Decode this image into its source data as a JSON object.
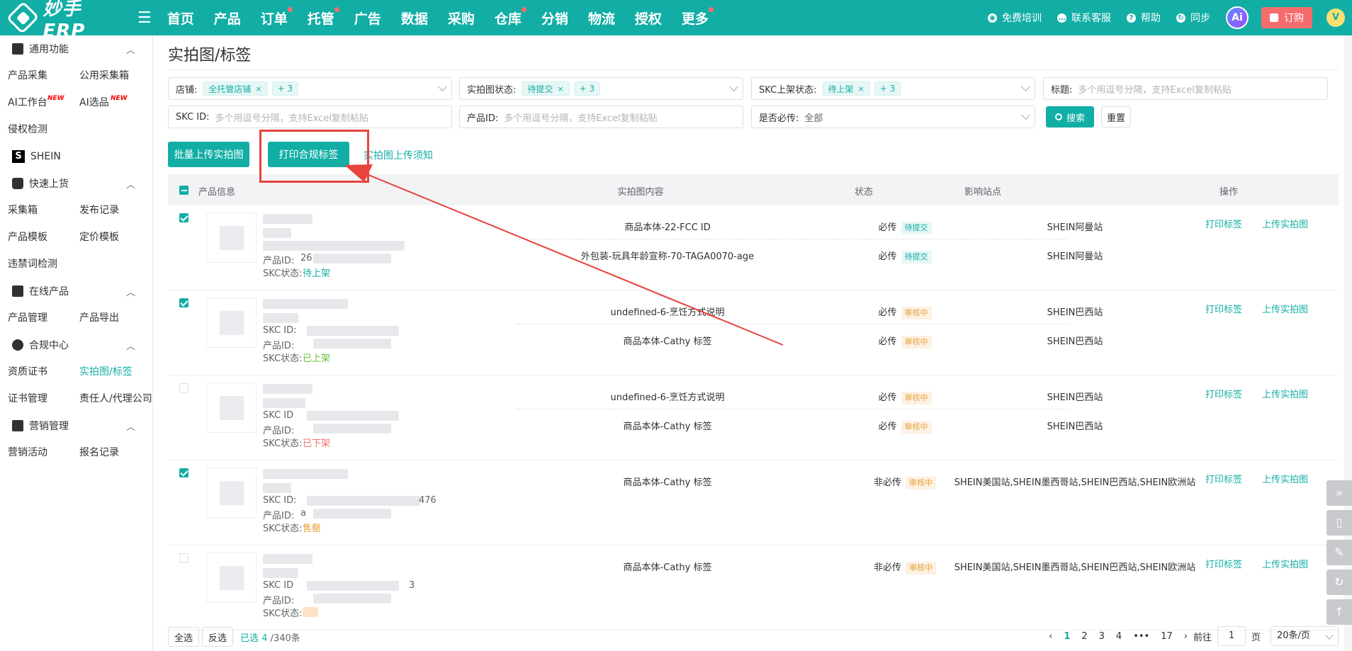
{
  "brand": {
    "logo_text": "妙手ERP"
  },
  "nav": [
    {
      "label": "首页",
      "dot": false
    },
    {
      "label": "产品",
      "dot": false
    },
    {
      "label": "订单",
      "dot": true
    },
    {
      "label": "托管",
      "dot": true
    },
    {
      "label": "广告",
      "dot": false
    },
    {
      "label": "数据",
      "dot": false
    },
    {
      "label": "采购",
      "dot": false
    },
    {
      "label": "仓库",
      "dot": true
    },
    {
      "label": "分销",
      "dot": false
    },
    {
      "label": "物流",
      "dot": false
    },
    {
      "label": "授权",
      "dot": false
    },
    {
      "label": "更多",
      "dot": true
    }
  ],
  "tools": {
    "training": "免费培训",
    "contact": "联系客服",
    "help": "帮助",
    "sync": "同步",
    "ai": "Ai",
    "order": "订购",
    "user_initial": "V"
  },
  "sidebar": {
    "general": {
      "title": "通用功能",
      "items": [
        "产品采集",
        "公用采集箱",
        "AI工作台",
        "AI选品",
        "侵权检测"
      ],
      "new_tag": "NEW"
    },
    "shein": "SHEIN",
    "quick": {
      "title": "快速上货",
      "items": [
        "采集箱",
        "发布记录",
        "产品模板",
        "定价模板",
        "违禁词检测"
      ]
    },
    "online": {
      "title": "在线产品",
      "items": [
        "产品管理",
        "产品导出"
      ]
    },
    "compliance": {
      "title": "合规中心",
      "items": [
        "资质证书",
        "实拍图/标签",
        "证书管理",
        "责任人/代理公司"
      ]
    },
    "marketing": {
      "title": "营销管理",
      "items": [
        "营销活动",
        "报名记录"
      ]
    }
  },
  "page": {
    "title": "实拍图/标签"
  },
  "filters": {
    "store": {
      "label": "店铺:",
      "tag": "全托管店铺",
      "more": "+ 3"
    },
    "photo_status": {
      "label": "实拍图状态:",
      "tag": "待提交",
      "more": "+ 3"
    },
    "skc_status": {
      "label": "SKC上架状态:",
      "tag": "待上架",
      "more": "+ 3"
    },
    "title": {
      "label": "标题:",
      "placeholder": "多个用逗号分隔，支持Excel复制粘贴"
    },
    "skc_id": {
      "label": "SKC ID:",
      "placeholder": "多个用逗号分隔，支持Excel复制粘贴"
    },
    "product_id": {
      "label": "产品ID:",
      "placeholder": "多个用逗号分隔，支持Excel复制粘贴"
    },
    "required": {
      "label": "是否必传:",
      "value": "全部"
    },
    "search": "搜索",
    "reset": "重置"
  },
  "actions": {
    "batch_upload": "批量上传实拍图",
    "print_labels": "打印合规标签",
    "notice": "实拍图上传须知"
  },
  "table": {
    "headers": {
      "product": "产品信息",
      "content": "实拍图内容",
      "status": "状态",
      "sites": "影响站点",
      "ops": "操作"
    },
    "print_label": "打印标签",
    "upload_label": "上传实拍图",
    "rows": [
      {
        "checked": true,
        "skc_id_label": "",
        "product_id_label": "产品ID:",
        "product_id_visible": "26",
        "skc_status_label": "SKC状态:",
        "skc_status": "待上架",
        "skc_tail": "",
        "subs": [
          {
            "content": "商品本体-22-FCC ID",
            "req": "必传",
            "status": "待提交",
            "site": "SHEIN阿曼站"
          },
          {
            "content": "外包装-玩具年龄宣称-70-TAGA0070-age",
            "req": "必传",
            "status": "待提交",
            "site": "SHEIN阿曼站"
          }
        ]
      },
      {
        "checked": true,
        "skc_id_label": "SKC ID:",
        "product_id_label": "产品ID:",
        "product_id_visible": "",
        "skc_status_label": "SKC状态:",
        "skc_status": "已上架",
        "skc_tail": "",
        "subs": [
          {
            "content": "undefined-6-烹饪方式说明",
            "req": "必传",
            "status": "审核中",
            "site": "SHEIN巴西站"
          },
          {
            "content": "商品本体-Cathy 标签",
            "req": "必传",
            "status": "审核中",
            "site": "SHEIN巴西站"
          }
        ]
      },
      {
        "checked": false,
        "skc_id_label": "SKC ID",
        "product_id_label": "产品ID:",
        "product_id_visible": "",
        "skc_status_label": "SKC状态:",
        "skc_status": "已下架",
        "skc_tail": "",
        "subs": [
          {
            "content": "undefined-6-烹饪方式说明",
            "req": "必传",
            "status": "审核中",
            "site": "SHEIN巴西站"
          },
          {
            "content": "商品本体-Cathy 标签",
            "req": "必传",
            "status": "审核中",
            "site": "SHEIN巴西站"
          }
        ]
      },
      {
        "checked": true,
        "skc_id_label": "SKC ID:",
        "product_id_label": "产品ID:",
        "product_id_visible": "a",
        "skc_status_label": "SKC状态:",
        "skc_status": "售罄",
        "skc_tail": "476",
        "subs": [
          {
            "content": "商品本体-Cathy 标签",
            "req": "非必传",
            "status": "审核中",
            "site": "SHEIN美国站,SHEIN墨西哥站,SHEIN巴西站,SHEIN欧洲站"
          }
        ]
      },
      {
        "checked": false,
        "skc_id_label": "SKC ID",
        "product_id_label": "产品ID:",
        "product_id_visible": "",
        "skc_status_label": "SKC状态:",
        "skc_status": "",
        "skc_tail": "3",
        "subs": [
          {
            "content": "商品本体-Cathy 标签",
            "req": "非必传",
            "status": "审核中",
            "site": "SHEIN美国站,SHEIN墨西哥站,SHEIN巴西站,SHEIN欧洲站"
          }
        ]
      }
    ]
  },
  "footer": {
    "select_all": "全选",
    "invert": "反选",
    "selected_prefix": "已选",
    "selected_count": "4",
    "total": "/340条",
    "pages": [
      "1",
      "2",
      "3",
      "4",
      "•••",
      "17"
    ],
    "goto_label": "前往",
    "goto_value": "1",
    "page_unit": "页",
    "page_size": "20条/页"
  },
  "colors": {
    "accent": "#12aea5",
    "danger": "#f56c6c",
    "annotation": "#e8433d"
  }
}
